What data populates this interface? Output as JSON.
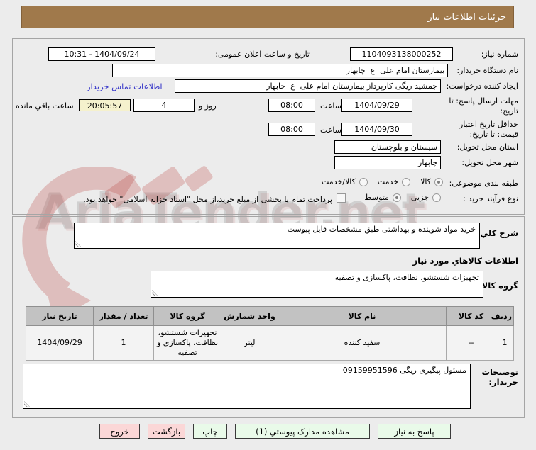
{
  "colors": {
    "header_bg": "#a0794b",
    "button_green": "#e9fae9",
    "button_pink": "#fbd7d7",
    "highlight_yellow": "#f5f1cd",
    "link_blue": "#3636c9",
    "table_header_bg": "#c2c2c2"
  },
  "header": {
    "title": "جزئیات اطلاعات نیاز"
  },
  "watermark": {
    "text": "AriaTender.net"
  },
  "fields": {
    "need_number": {
      "label": "شماره نیاز:",
      "value": "1104093138000252"
    },
    "announce": {
      "label": "تاریخ و ساعت اعلان عمومی:",
      "value": "1404/09/24 - 10:31"
    },
    "buyer_org": {
      "label": "نام دستگاه خریدار:",
      "value": "بیمارستان امام علی  ع  چابهار"
    },
    "creator": {
      "label": "ایجاد کننده درخواست:",
      "value": "جمشید ریگی کارپرداز بیمارستان امام علی  ع  چابهار"
    },
    "contact_link": {
      "label": "اطلاعات تماس خریدار"
    },
    "deadline": {
      "label": "مهلت ارسال پاسخ: تا تاریخ:",
      "date": "1404/09/29",
      "hour_label": "ساعت",
      "time": "08:00"
    },
    "remaining": {
      "days": "4",
      "days_label": "روز و",
      "time": "20:05:57",
      "suffix_label": "ساعت باقي مانده"
    },
    "validity": {
      "label": "حداقل تاریخ اعتبار قیمت: تا تاریخ:",
      "date": "1404/09/30",
      "hour_label": "ساعت",
      "time": "08:00"
    },
    "province": {
      "label": "استان محل تحویل:",
      "value": "سیستان و بلوچستان"
    },
    "city": {
      "label": "شهر محل تحویل:",
      "value": "چابهار"
    },
    "subject_class": {
      "label": "طبقه بندی موضوعی:",
      "options": [
        {
          "label": "کالا",
          "checked": true
        },
        {
          "label": "خدمت",
          "checked": false
        },
        {
          "label": "کالا/خدمت",
          "checked": false
        }
      ]
    },
    "process_type": {
      "label": "نوع فرآیند خرید :",
      "options": [
        {
          "label": "جزیی",
          "checked": false
        },
        {
          "label": "متوسط",
          "checked": true
        }
      ],
      "treasury": {
        "label": "پرداخت تمام یا بخشی از مبلغ خرید،از محل \"اسناد خزانه اسلامی\" خواهد بود.",
        "checked": false
      }
    },
    "general_desc": {
      "label": "شرح کلي نیاز:",
      "value": "خرید مواد شوینده و بهداشتی طبق مشخصات فایل پیوست"
    },
    "goods_section_title": "اطلاعات کالاهاي مورد نیاز",
    "goods_group": {
      "label": "گروه کالا:",
      "value": "تجهیزات شستشو، نظافت، پاکسازی و تصفیه"
    },
    "buyer_notes": {
      "label": "توضیحات خریدار:",
      "value": "مسئول پیگیری ریگی 09159951596"
    }
  },
  "table": {
    "headers": [
      "ردیف",
      "کد کالا",
      "نام کالا",
      "واحد شمارش",
      "گروه کالا",
      "تعداد / مقدار",
      "تاریخ نیاز"
    ],
    "rows": [
      [
        "1",
        "--",
        "سفید کننده",
        "لیتر",
        "تجهیزات شستشو، نظافت، پاکسازی و تصفیه",
        "1",
        "1404/09/29"
      ]
    ]
  },
  "buttons": [
    {
      "label": "پاسخ به نیاز",
      "style": "green"
    },
    {
      "label": "مشاهده مدارک پیوستي (1)",
      "style": "green"
    },
    {
      "label": "چاپ",
      "style": "green"
    },
    {
      "label": "بازگشت",
      "style": "pink"
    },
    {
      "label": "خروج",
      "style": "pink"
    }
  ]
}
